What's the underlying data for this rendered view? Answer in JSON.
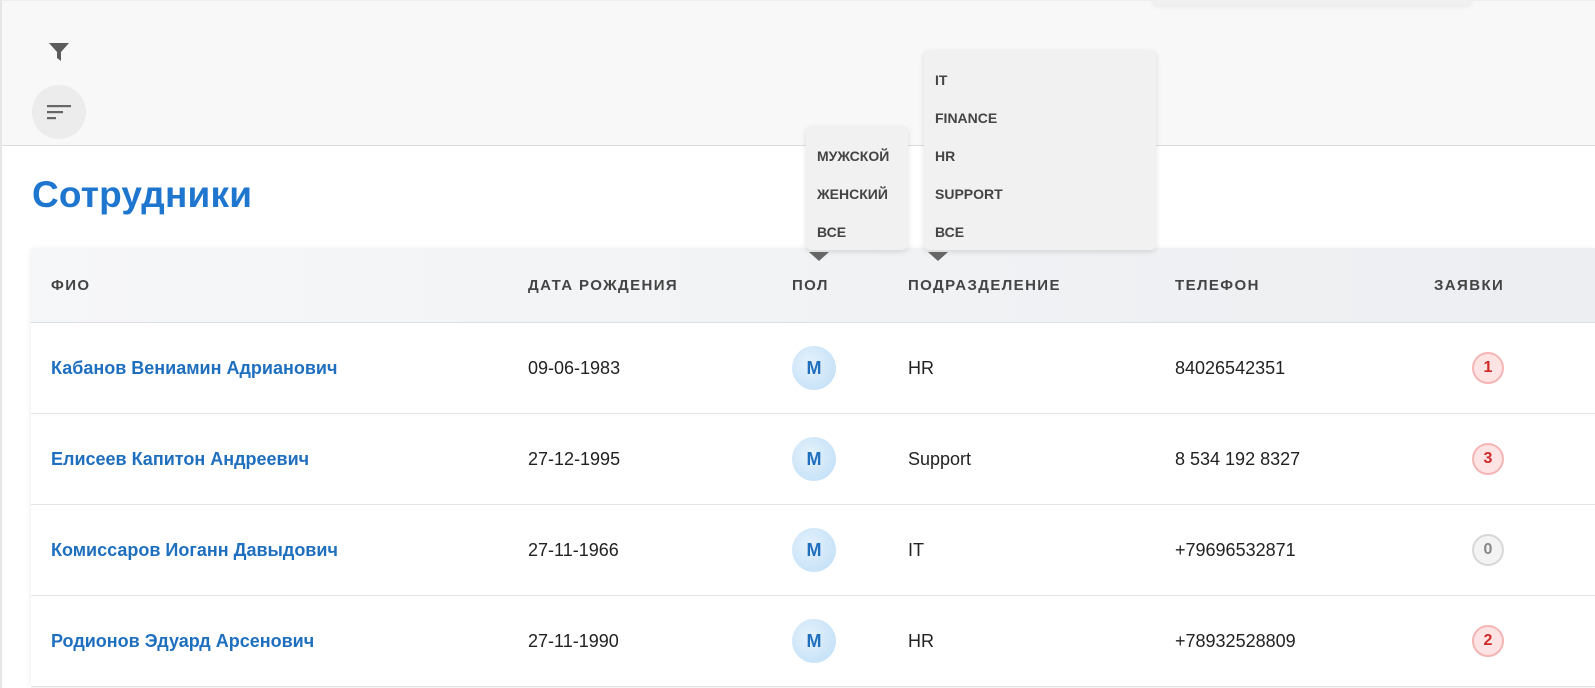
{
  "page": {
    "title": "Сотрудники"
  },
  "toolbar": {
    "filter_icon": "filter-icon",
    "sort_icon": "sort-icon"
  },
  "table": {
    "headers": {
      "name": "ФИО",
      "birth": "ДАТА РОЖДЕНИЯ",
      "gender": "ПОЛ",
      "dept": "ПОДРАЗДЕЛЕНИЕ",
      "phone": "ТЕЛЕФОН",
      "requests": "ЗАЯВКИ"
    },
    "rows": [
      {
        "name": "Кабанов Вениамин Адрианович",
        "birth": "09-06-1983",
        "gender": "М",
        "dept": "HR",
        "phone": "84026542351",
        "requests": "1"
      },
      {
        "name": "Елисеев Капитон Андреевич",
        "birth": "27-12-1995",
        "gender": "М",
        "dept": "Support",
        "phone": "8 534 192 8327",
        "requests": "3"
      },
      {
        "name": "Комиссаров Иоганн Давыдович",
        "birth": "27-11-1966",
        "gender": "М",
        "dept": "IT",
        "phone": "+79696532871",
        "requests": "0"
      },
      {
        "name": "Родионов Эдуард Арсенович",
        "birth": "27-11-1990",
        "gender": "М",
        "dept": "HR",
        "phone": "+78932528809",
        "requests": "2"
      }
    ]
  },
  "gender_filter": {
    "options": [
      "МУЖСКОЙ",
      "ЖЕНСКИЙ",
      "ВСЕ"
    ]
  },
  "dept_filter": {
    "options": [
      "IT",
      "FINANCE",
      "HR",
      "SUPPORT",
      "ВСЕ"
    ]
  },
  "colors": {
    "accent": "#1f76cf",
    "badge_red": "#d02828",
    "badge_gray": "#888888"
  }
}
